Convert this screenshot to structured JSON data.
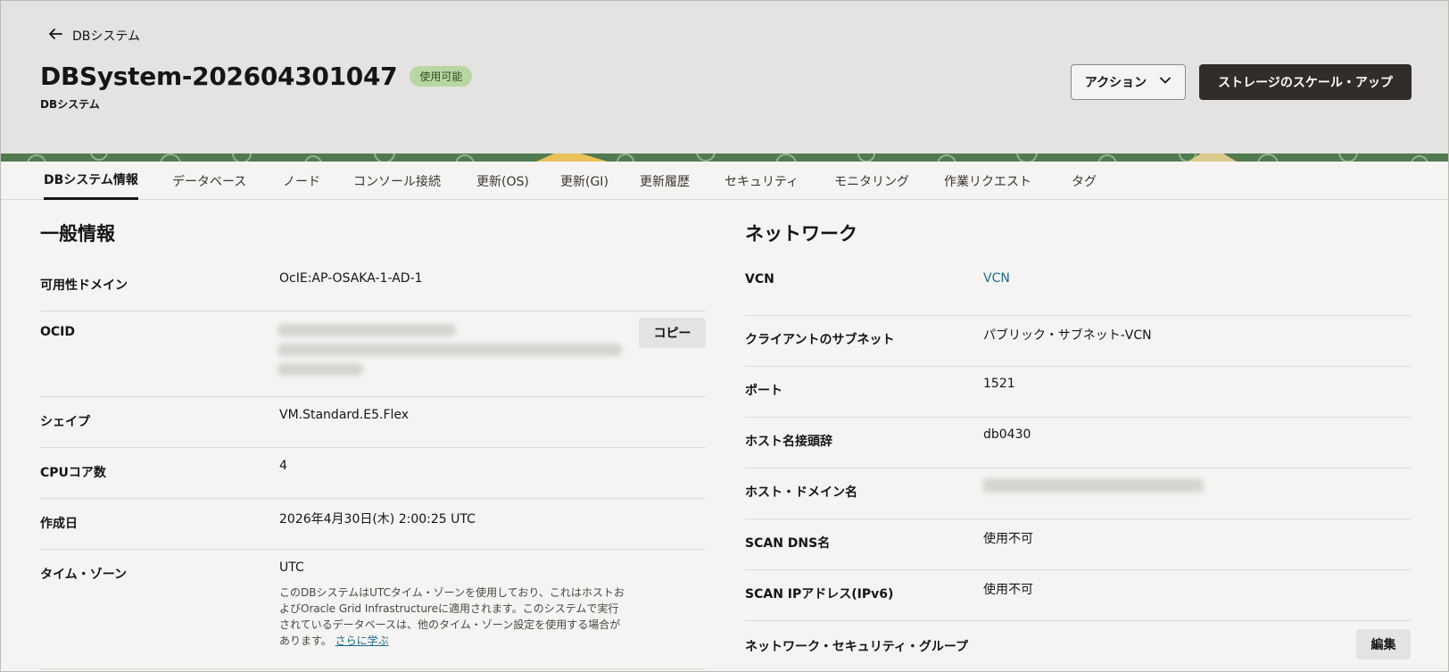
{
  "header": {
    "back_label": "DBシステム",
    "title": "DBSystem-202604301047",
    "status": "使用可能",
    "subtitle": "DBシステム",
    "actions_label": "アクション",
    "scale_label": "ストレージのスケール・アップ"
  },
  "tabs": [
    {
      "label": "DBシステム情報"
    },
    {
      "label": "データベース"
    },
    {
      "label": "ノード"
    },
    {
      "label": "コンソール接続"
    },
    {
      "label": "更新(OS)"
    },
    {
      "label": "更新(GI)"
    },
    {
      "label": "更新履歴"
    },
    {
      "label": "セキュリティ"
    },
    {
      "label": "モニタリング"
    },
    {
      "label": "作業リクエスト"
    },
    {
      "label": "タグ"
    }
  ],
  "general": {
    "title": "一般情報",
    "ad_label": "可用性ドメイン",
    "ad_value": "OcIE:AP-OSAKA-1-AD-1",
    "ocid_label": "OCID",
    "copy_label": "コピー",
    "shape_label": "シェイプ",
    "shape_value": "VM.Standard.E5.Flex",
    "cpu_label": "CPUコア数",
    "cpu_value": "4",
    "created_label": "作成日",
    "created_value": "2026年4月30日(木) 2:00:25 UTC",
    "tz_label": "タイム・ゾーン",
    "tz_value": "UTC",
    "tz_note": "このDBシステムはUTCタイム・ゾーンを使用しており、これはホストおよびOracle Grid Infrastructureに適用されます。このシステムで実行されているデータベースは、他のタイム・ゾーン設定を使用する場合があります。",
    "tz_learn_more": "さらに学ぶ"
  },
  "network": {
    "title": "ネットワーク",
    "vcn_label": "VCN",
    "vcn_value": "VCN",
    "subnet_label": "クライアントのサブネット",
    "subnet_value": "パブリック・サブネット-VCN",
    "port_label": "ポート",
    "port_value": "1521",
    "hostname_label": "ホスト名接頭辞",
    "hostname_value": "db0430",
    "domain_label": "ホスト・ドメイン名",
    "scan_dns_label": "SCAN DNS名",
    "scan_dns_value": "使用不可",
    "scan_ip_label": "SCAN IPアドレス(IPv6)",
    "scan_ip_value": "使用不可",
    "nsg_label": "ネットワーク・セキュリティ・グループ",
    "edit_label": "編集"
  }
}
